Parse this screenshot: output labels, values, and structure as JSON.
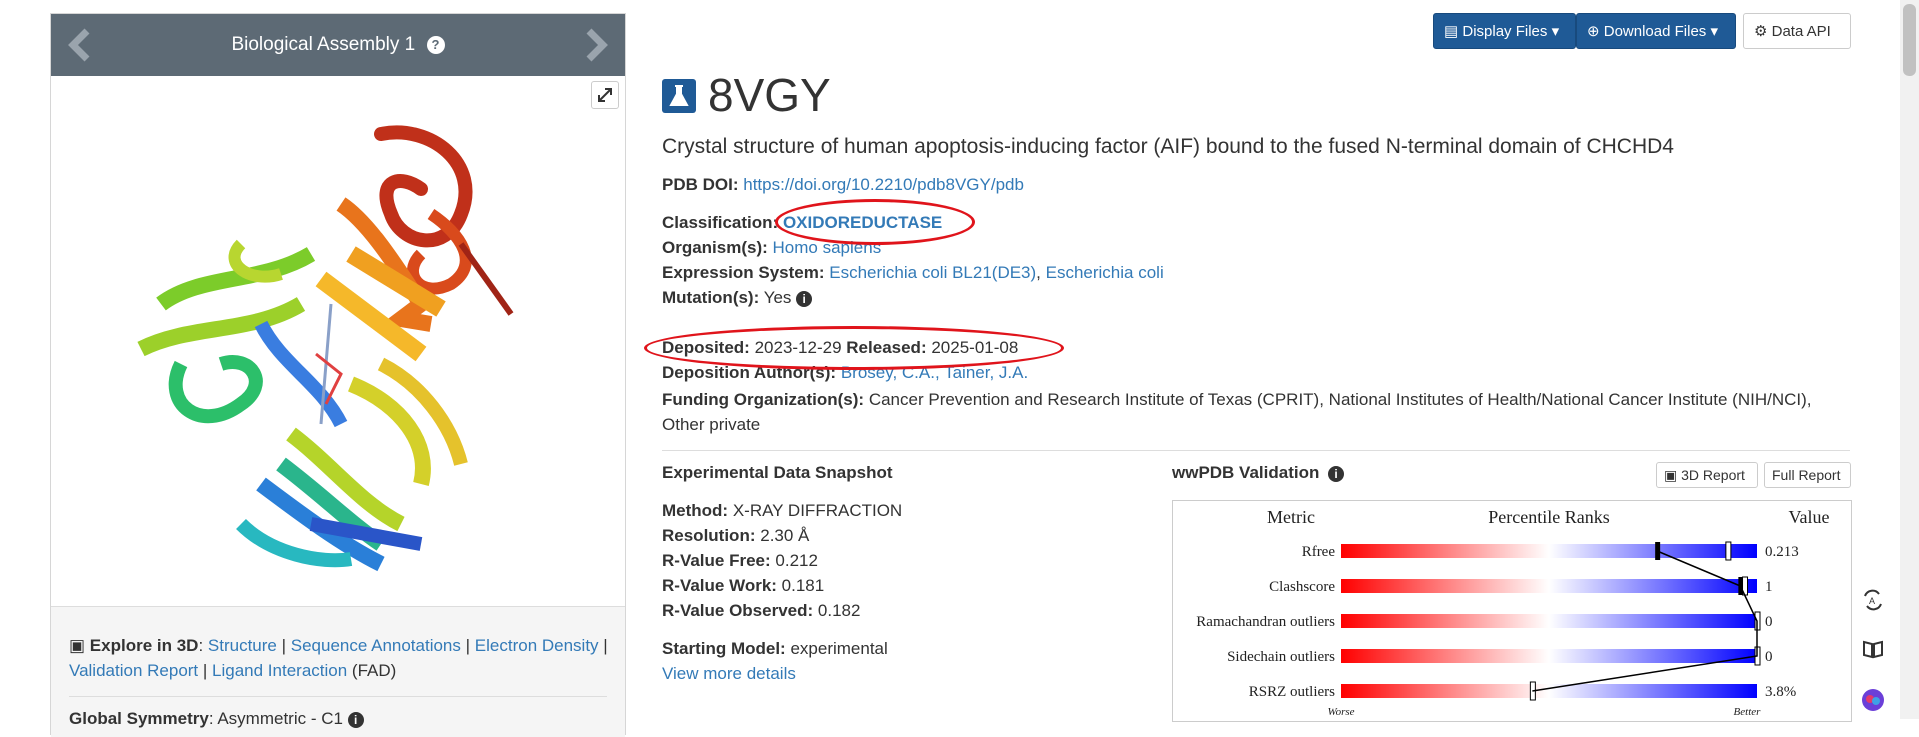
{
  "viewer": {
    "assembly_title": "Biological Assembly 1",
    "explore_label": "Explore in 3D",
    "explore_links": [
      "Structure",
      "Sequence Annotations",
      "Electron Density",
      "Validation Report",
      "Ligand Interaction"
    ],
    "ligand_suffix": "(FAD)",
    "symmetry_label": "Global Symmetry",
    "symmetry_value": ": Asymmetric - C1"
  },
  "toolbar": {
    "display_files": "Display Files",
    "download_files": "Download Files",
    "data_api": "Data API"
  },
  "entry": {
    "id": "8VGY",
    "title": "Crystal structure of human apoptosis-inducing factor (AIF) bound to the fused N-terminal domain of CHCHD4",
    "doi_label": "PDB DOI:",
    "doi": "https://doi.org/10.2210/pdb8VGY/pdb",
    "classification_label": "Classification:",
    "classification": "OXIDOREDUCTASE",
    "organism_label": "Organism(s):",
    "organism": "Homo sapiens",
    "expression_label": "Expression System:",
    "expression_1": "Escherichia coli BL21(DE3)",
    "expression_2": "Escherichia coli",
    "mutation_label": "Mutation(s):",
    "mutation": "Yes",
    "deposited_label": "Deposited:",
    "deposited": "2023-12-29",
    "released_label": "Released:",
    "released": "2025-01-08",
    "authors_label": "Deposition Author(s):",
    "authors": "Brosey, C.A., Tainer, J.A.",
    "funding_label": "Funding Organization(s):",
    "funding": "Cancer Prevention and Research Institute of Texas (CPRIT), National Institutes of Health/National Cancer Institute (NIH/NCI), Other private"
  },
  "snapshot": {
    "title": "Experimental Data Snapshot",
    "method_label": "Method:",
    "method": "X-RAY DIFFRACTION",
    "resolution_label": "Resolution:",
    "resolution": "2.30 Å",
    "rfree_label": "R-Value Free:",
    "rfree": "0.212",
    "rwork_label": "R-Value Work:",
    "rwork": "0.181",
    "robs_label": "R-Value Observed:",
    "robs": "0.182",
    "starting_label": "Starting Model:",
    "starting": "experimental",
    "view_more": "View more details"
  },
  "validation": {
    "title": "wwPDB Validation",
    "report_3d": "3D Report",
    "full_report": "Full Report",
    "col_metric": "Metric",
    "col_ranks": "Percentile Ranks",
    "col_value": "Value",
    "worse": "Worse",
    "better": "Better",
    "colors": {
      "bad": "#ff0000",
      "good": "#0000ff"
    }
  },
  "chart_data": {
    "type": "bar",
    "title": "",
    "metrics": [
      "Rfree",
      "Clashscore",
      "Ramachandran outliers",
      "Sidechain outliers",
      "RSRZ outliers"
    ],
    "values_text": [
      "0.213",
      "1",
      "0",
      "0",
      "3.8%"
    ],
    "percentile_all": [
      76,
      96,
      100,
      100,
      46
    ],
    "percentile_similar": [
      93,
      97,
      100,
      100,
      46
    ]
  }
}
